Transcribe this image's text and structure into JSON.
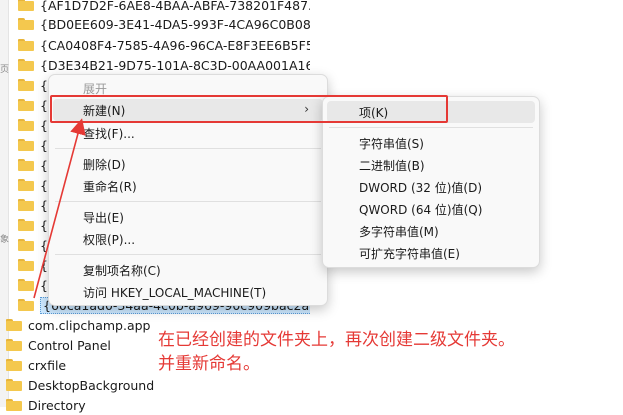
{
  "tree": {
    "top_items": [
      "{AF1D7D2F-6AE8-4BAA-ABFA-738201F487...",
      "{BD0EE609-3E41-4DA5-993F-4CA96C0B08...",
      "{CA0408F4-7585-4A96-96CA-E8F3EE6B5F5...",
      "{D3E34B21-9D75-101A-8C3D-00AA001A16...",
      "{D",
      "{E",
      "{e",
      "{E",
      "{E",
      "{E",
      "{E",
      "{F",
      "{F",
      "{F",
      "{F",
      "{60ca1ad0-34aa-4c0b-a969-90c909bac2a"
    ],
    "bottom_items": [
      "com.clipchamp.app",
      "Control Panel",
      "crxfile",
      "DesktopBackground",
      "Directory"
    ]
  },
  "left_strip": [
    "页",
    "象"
  ],
  "context_menu": {
    "expand": "展开",
    "new": "新建(N)",
    "find": "查找(F)...",
    "delete": "删除(D)",
    "rename": "重命名(R)",
    "export": "导出(E)",
    "permissions": "权限(P)...",
    "copy_key_name": "复制项名称(C)",
    "visit": "访问 HKEY_LOCAL_MACHINE(T)"
  },
  "submenu": {
    "key": "项(K)",
    "string_value": "字符串值(S)",
    "binary_value": "二进制值(B)",
    "dword_value": "DWORD (32 位)值(D)",
    "qword_value": "QWORD (64 位)值(Q)",
    "multi_string_value": "多字符串值(M)",
    "expandable_string_value": "可扩充字符串值(E)"
  },
  "annotation": {
    "line1": "在已经创建的文件夹上，再次创建二级文件夹。",
    "line2": "并重新命名。",
    "color": "#e53935"
  }
}
